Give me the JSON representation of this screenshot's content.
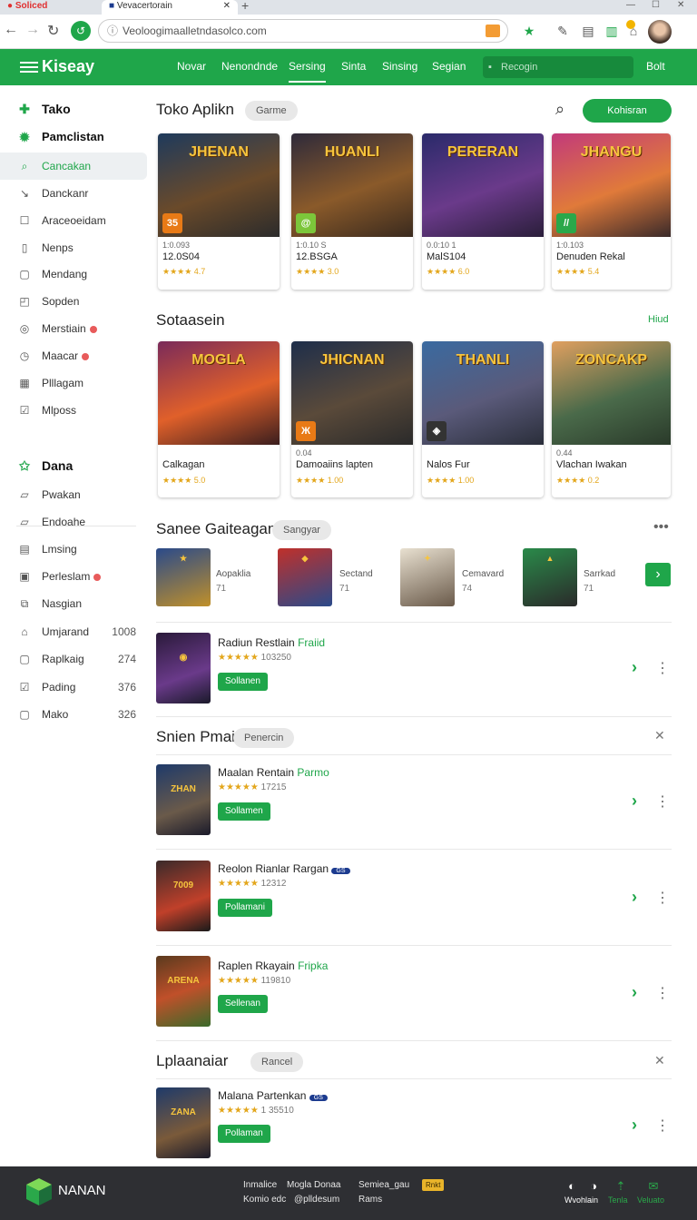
{
  "browser": {
    "tabs": [
      {
        "label": "Soliced"
      },
      {
        "label": "Vevacertorain"
      }
    ],
    "new_tab": "+",
    "url": "Veoloogimaalletndasolco.com"
  },
  "header": {
    "logo": "Kiseay",
    "nav": [
      "Novar",
      "Nenondnde",
      "Sersing",
      "Sinta",
      "Sinsing",
      "Segian"
    ],
    "search_placeholder": "Recogin",
    "right_label": "Bolt"
  },
  "sidebar": {
    "primary": [
      {
        "label": "Tako",
        "icon": "plus-circle-icon"
      },
      {
        "label": "Pamclistan",
        "icon": "gear-icon"
      },
      {
        "label": "Cancakan",
        "icon": "search-icon"
      },
      {
        "label": "Danckanr",
        "icon": "arrow-icon"
      },
      {
        "label": "Araceoeidam",
        "icon": "box-icon"
      },
      {
        "label": "Nenps",
        "icon": "doc-icon"
      },
      {
        "label": "Mendang",
        "icon": "square-icon"
      },
      {
        "label": "Sopden",
        "icon": "window-icon"
      },
      {
        "label": "Merstiain",
        "icon": "clock-icon"
      },
      {
        "label": "Maacar",
        "icon": "clock-icon"
      },
      {
        "label": "Plllagam",
        "icon": "grid-icon"
      },
      {
        "label": "Mlposs",
        "icon": "check-box-icon"
      }
    ],
    "secondary_title": "Dana",
    "secondary": [
      {
        "label": "Pwakan",
        "count": ""
      },
      {
        "label": "Endoahe",
        "count": ""
      },
      {
        "label": "Lmsing",
        "count": ""
      },
      {
        "label": "Perleslam",
        "count": ""
      },
      {
        "label": "Nasgian",
        "count": ""
      },
      {
        "label": "Umjarand",
        "count": "1008"
      },
      {
        "label": "Raplkaig",
        "count": "274"
      },
      {
        "label": "Pading",
        "count": "376"
      },
      {
        "label": "Mako",
        "count": "326"
      }
    ]
  },
  "store": {
    "title": "Toko Aplikn",
    "chip": "Garme",
    "button": "Kohisran",
    "cards": [
      {
        "art": "JHENAN",
        "badge": "35",
        "meta": "1:0.093",
        "name": "12.0S04",
        "rating": "★★★★ 4.7"
      },
      {
        "art": "HUANLI",
        "badge": "@",
        "meta": "1:0.10 S",
        "name": "12.BSGA",
        "rating": "★★★★ 3.0"
      },
      {
        "art": "PERERAN",
        "badge": "",
        "meta": "0.0:10 1",
        "name": "MalS104",
        "rating": "★★★★ 6.0"
      },
      {
        "art": "JHANGU",
        "badge": "//",
        "meta": "1:0.103",
        "name": "Denuden Rekal",
        "rating": "★★★★ 5.4"
      }
    ]
  },
  "section2": {
    "title": "Sotaasein",
    "link": "Hiud",
    "cards": [
      {
        "art": "MOGLA",
        "meta": "",
        "name": "Calkagan",
        "rating": "★★★★ 5.0"
      },
      {
        "art": "JHICNAN",
        "meta": "0.04",
        "name": "Damoaiins lapten",
        "rating": "★★★★ 1.00"
      },
      {
        "art": "THANLI",
        "meta": "",
        "name": "Nalos Fur",
        "rating": "★★★★ 1.00"
      },
      {
        "art": "ZONCAKP",
        "meta": "0.44",
        "name": "Vlachan Iwakan",
        "rating": "★★★★ 0.2"
      }
    ]
  },
  "section3": {
    "title": "Sanee Gaiteagan",
    "chip": "Sangyar",
    "items": [
      {
        "name": "Aopaklia",
        "value": "71"
      },
      {
        "name": "Sectand",
        "value": "71"
      },
      {
        "name": "Cemavard",
        "value": "74"
      },
      {
        "name": "Sarrkad",
        "value": "71"
      }
    ],
    "featured": {
      "name": "Radiun Restlain",
      "tag": "Fraiid",
      "rating": "★★★★★",
      "count": "103250",
      "button": "Sollanen"
    }
  },
  "section4": {
    "title": "Snien Pmai",
    "chip": "Penercin",
    "rows": [
      {
        "name": "Maalan Rentain",
        "tag": "Parmo",
        "badge": "",
        "rating": "★★★★★",
        "count": "17215",
        "button": "Sollamen",
        "art": "ZHAN"
      },
      {
        "name": "Reolon Rianlar Rargan",
        "tag": "",
        "badge": "GS",
        "rating": "★★★★★",
        "count": "12312",
        "button": "Pollamani",
        "art": "7009"
      },
      {
        "name": "Raplen Rkayain",
        "tag": "Fripka",
        "badge": "",
        "rating": "★★★★★",
        "count": "119810",
        "button": "Sellenan",
        "art": "ARENA"
      }
    ]
  },
  "section5": {
    "title": "Lplaanaiar",
    "chip": "Rancel",
    "rows": [
      {
        "name": "Malana Partenkan",
        "badge": "GS",
        "rating": "★★★★★",
        "count": "1 35510",
        "button": "Pollaman",
        "art": "ZANA"
      }
    ]
  },
  "footer": {
    "brand": "NANAN",
    "links": [
      "Inmalice",
      "Mogla Donaa",
      "Semiea_gau",
      "Komio edc",
      "@plldesum",
      "Rams"
    ],
    "badge": "Rnkt",
    "actions": [
      {
        "label": "Wvohlain",
        "icon": "refresh-icon"
      },
      {
        "label": "Tenla",
        "icon": "arrow-up-icon"
      },
      {
        "label": "Veluato",
        "icon": "mail-icon"
      }
    ]
  },
  "colors": {
    "brand": "#1fa64a",
    "footer": "#2e2f33",
    "star": "#e3a61b"
  }
}
